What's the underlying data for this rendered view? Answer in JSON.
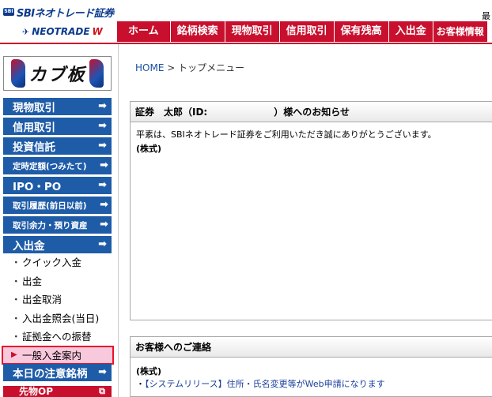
{
  "header": {
    "brand_mark": "SBI",
    "brand_title": "SBIネオトレード証券",
    "sub_brand_prefix": "NEOTRADE",
    "sub_brand_suffix": "W",
    "corner_text": "最"
  },
  "nav": {
    "items": [
      "ホーム",
      "銘柄検索",
      "現物取引",
      "信用取引",
      "保有残高",
      "入出金",
      "お客様情報"
    ]
  },
  "sidebar": {
    "logo_text": "カブ板",
    "buttons": [
      {
        "label": "現物取引",
        "arrow": "➡"
      },
      {
        "label": "信用取引",
        "arrow": "➡"
      },
      {
        "label": "投資信託",
        "arrow": "➡"
      },
      {
        "label": "定時定額(つみたて)",
        "arrow": "➡"
      },
      {
        "label": "IPO・PO",
        "arrow": "➡"
      },
      {
        "label": "取引履歴(前日以前)",
        "arrow": "➡"
      },
      {
        "label": "取引余力・預り資産",
        "arrow": "➡"
      },
      {
        "label": "入出金",
        "arrow": "➡"
      }
    ],
    "sub_items": [
      {
        "bullet": "・",
        "label": "クイック入金"
      },
      {
        "bullet": "・",
        "label": "出金"
      },
      {
        "bullet": "・",
        "label": "出金取消"
      },
      {
        "bullet": "・",
        "label": "入出金照会(当日)"
      },
      {
        "bullet": "・",
        "label": "証拠金への振替"
      },
      {
        "bullet": "▶",
        "label": "一般入金案内"
      }
    ],
    "attention": {
      "label": "本日の注意銘柄",
      "arrow": "➡"
    },
    "bottom_partial": "先物OP"
  },
  "main": {
    "breadcrumb_home": "HOME",
    "breadcrumb_sep": " > ",
    "breadcrumb_current": "トップメニュー",
    "notice": {
      "title": "証券　太郎（ID:　　　　　　　）様へのお知らせ",
      "line1": "平素は、SBIネオトレード証券をご利用いただき誠にありがとうございます。",
      "line2": "(株式)"
    },
    "contact": {
      "title": "お客様へのご連絡",
      "category": "(株式)",
      "link_bullet": "・",
      "link_text": "【システムリリース】住所・氏名変更等がWeb申請になります"
    }
  },
  "colors": {
    "nav_red": "#c8102e",
    "side_blue": "#1f5ca8",
    "active_bg": "#f8c8dc",
    "active_border": "#e8132b",
    "link_blue": "#1b3f9e"
  }
}
